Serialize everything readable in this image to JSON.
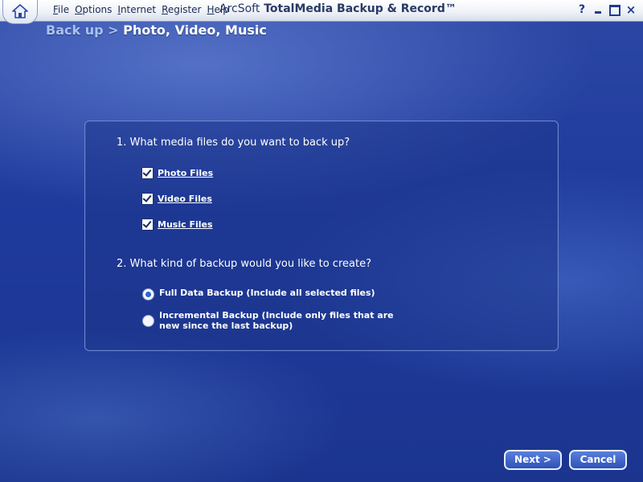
{
  "menu": {
    "items": [
      "File",
      "Options",
      "Internet",
      "Register",
      "Help"
    ]
  },
  "app_title": {
    "brand": "ArcSoft",
    "product": "TotalMedia Backup & Record™"
  },
  "window_controls": {
    "help": "?",
    "close": "×"
  },
  "breadcrumb": {
    "parent": "Back up",
    "separator": ">",
    "current": "Photo, Video, Music"
  },
  "question1": {
    "label": "1. What media files do you want to back up?",
    "options": [
      {
        "label": "Photo Files",
        "checked": true
      },
      {
        "label": "Video Files",
        "checked": true
      },
      {
        "label": "Music Files",
        "checked": true
      }
    ]
  },
  "question2": {
    "label": "2. What kind of backup would you like to create?",
    "options": [
      {
        "label": "Full Data Backup (Include all selected files)",
        "selected": true
      },
      {
        "label": "Incremental Backup (Include only files that are new since the last backup)",
        "selected": false
      }
    ]
  },
  "buttons": {
    "next": "Next >",
    "cancel": "Cancel"
  },
  "colors": {
    "background": "#1e3a9c",
    "panel_border": "#6b86cf",
    "button_fill": "#2d52b8"
  }
}
